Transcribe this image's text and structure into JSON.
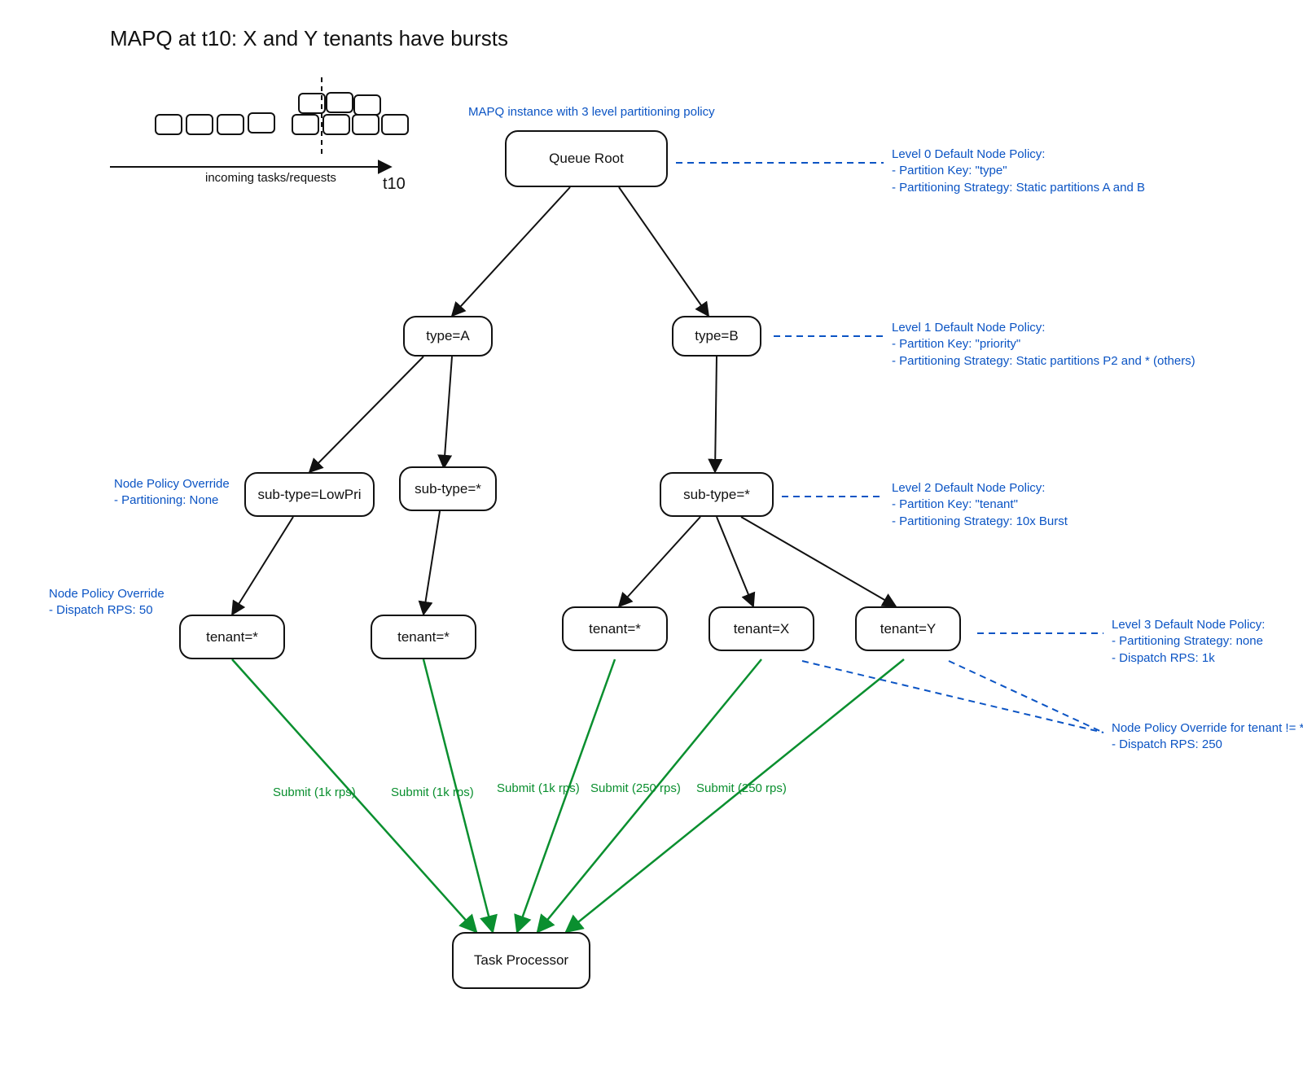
{
  "title": "MAPQ at t10: X and Y tenants have bursts",
  "incoming_label": "incoming tasks/requests",
  "time_marker": "t10",
  "top_annotation": "MAPQ instance with 3 level partitioning policy",
  "nodes": {
    "root": "Queue Root",
    "typeA": "type=A",
    "typeB": "type=B",
    "subLowPri": "sub-type=LowPri",
    "subStarA": "sub-type=*",
    "subStarB": "sub-type=*",
    "tenantA1": "tenant=*",
    "tenantA2": "tenant=*",
    "tenantB1": "tenant=*",
    "tenantX": "tenant=X",
    "tenantY": "tenant=Y",
    "processor": "Task Processor"
  },
  "annotations": {
    "level0": "Level 0 Default Node Policy:\n- Partition Key: \"type\"\n- Partitioning Strategy: Static partitions A and B",
    "level1": "Level 1 Default Node Policy:\n- Partition Key: \"priority\"\n- Partitioning Strategy: Static partitions P2 and * (others)",
    "level2": "Level 2 Default Node Policy:\n- Partition Key: \"tenant\"\n- Partitioning Strategy: 10x Burst",
    "level3": "Level 3 Default Node Policy:\n- Partitioning Strategy: none\n- Dispatch RPS: 1k",
    "override_left": "Node Policy Override\n- Partitioning: None",
    "override_rps50": "Node Policy Override\n- Dispatch RPS: 50",
    "override_tenant": "Node Policy Override for tenant != *\n- Dispatch RPS: 250"
  },
  "submits": {
    "s1": "Submit (1k rps)",
    "s2": "Submit (1k rps)",
    "s3": "Submit (1k rps)",
    "s4": "Submit (250 rps)",
    "s5": "Submit (250 rps)"
  }
}
